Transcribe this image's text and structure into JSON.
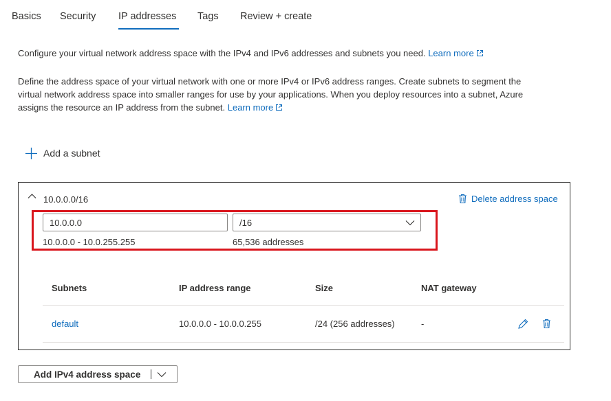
{
  "tabs": [
    {
      "label": "Basics"
    },
    {
      "label": "Security"
    },
    {
      "label": "IP addresses"
    },
    {
      "label": "Tags"
    },
    {
      "label": "Review + create"
    }
  ],
  "active_tab": "IP addresses",
  "intro": {
    "text": "Configure your virtual network address space with the IPv4 and IPv6 addresses and subnets you need.",
    "link": "Learn more"
  },
  "description": {
    "line1": "Define the address space of your virtual network with one or more IPv4 or IPv6 address ranges. Create subnets to segment the",
    "line2": "virtual network address space into smaller ranges for use by your applications. When you deploy resources into a subnet, Azure",
    "line3": "assigns the resource an IP address from the subnet.",
    "link": "Learn more"
  },
  "add_subnet_label": "Add a subnet",
  "address_space": {
    "title": "10.0.0.0/16",
    "delete_label": "Delete address space",
    "ip_value": "10.0.0.0",
    "prefix_value": "/16",
    "range_hint": "10.0.0.0 - 10.0.255.255",
    "count_hint": "65,536 addresses"
  },
  "subnets_table": {
    "headers": [
      "Subnets",
      "IP address range",
      "Size",
      "NAT gateway"
    ],
    "rows": [
      {
        "name": "default",
        "range": "10.0.0.0 - 10.0.0.255",
        "size": "/24 (256 addresses)",
        "nat": "-"
      }
    ]
  },
  "add_space_button": {
    "label": "Add IPv4 address space"
  },
  "colors": {
    "accent": "#0f6cbd",
    "highlight": "#d9151c",
    "text": "#323130"
  }
}
